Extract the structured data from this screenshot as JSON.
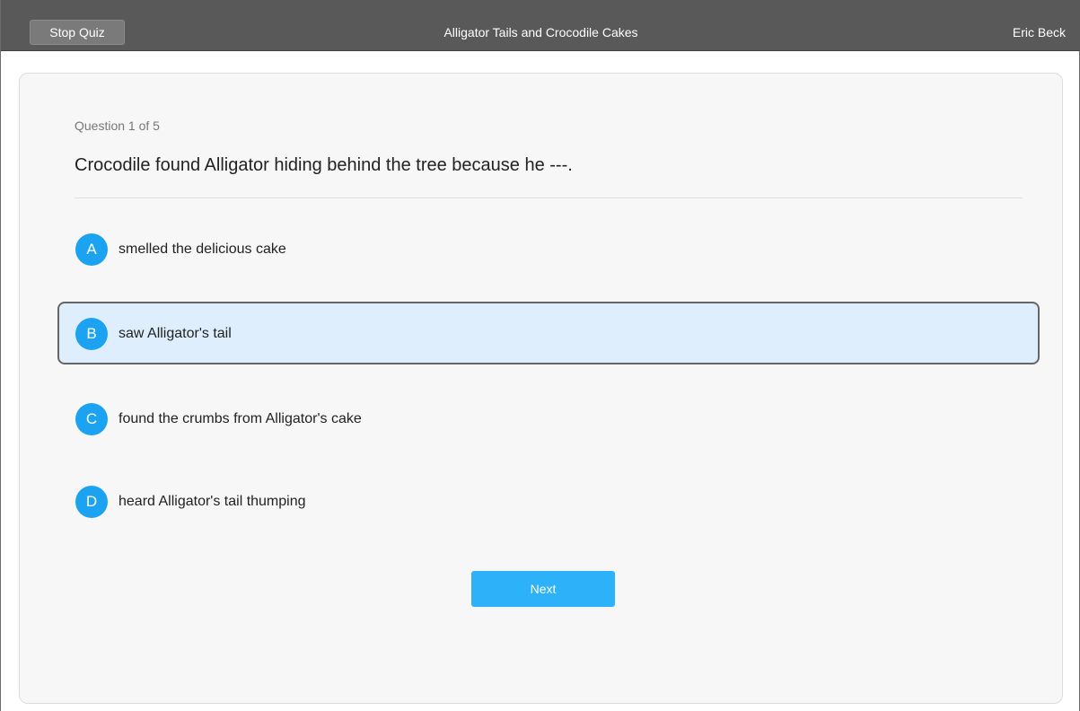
{
  "header": {
    "stop_label": "Stop Quiz",
    "title": "Alligator Tails and Crocodile Cakes",
    "user": "Eric Beck"
  },
  "question": {
    "counter": "Question 1 of 5",
    "text": "Crocodile found Alligator hiding behind the tree because he ---."
  },
  "options": [
    {
      "letter": "A",
      "text": "smelled the delicious cake",
      "selected": false
    },
    {
      "letter": "B",
      "text": "saw Alligator's tail",
      "selected": true
    },
    {
      "letter": "C",
      "text": "found the crumbs from Alligator's cake",
      "selected": false
    },
    {
      "letter": "D",
      "text": "heard Alligator's tail thumping",
      "selected": false
    }
  ],
  "footer": {
    "next_label": "Next"
  },
  "colors": {
    "header_bg": "#595959",
    "accent": "#1ba3f2",
    "selected_bg": "#deeefc",
    "card_bg": "#f7f7f7"
  }
}
